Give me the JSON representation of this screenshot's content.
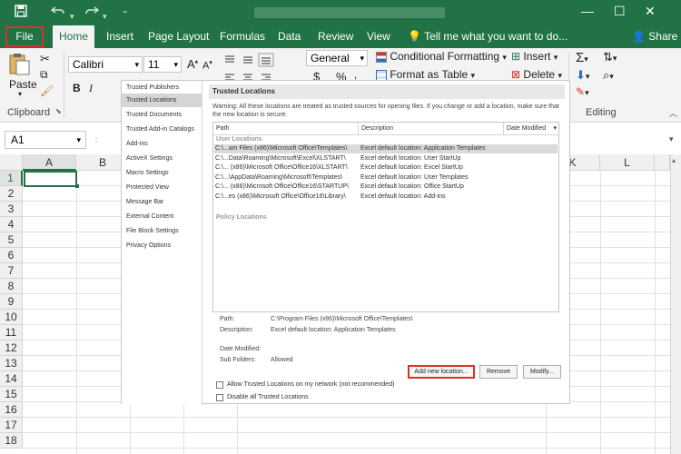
{
  "titlebar": {
    "save_icon": "save-icon",
    "undo_icon": "undo-icon",
    "redo_icon": "redo-icon",
    "accent": "#217346"
  },
  "tabs": [
    {
      "label": "File"
    },
    {
      "label": "Home"
    },
    {
      "label": "Insert"
    },
    {
      "label": "Page Layout"
    },
    {
      "label": "Formulas"
    },
    {
      "label": "Data"
    },
    {
      "label": "Review"
    },
    {
      "label": "View"
    }
  ],
  "tell_me": "Tell me what you want to do...",
  "share": "Share",
  "ribbon": {
    "paste": "Paste",
    "clipboard": "Clipboard",
    "font_name": "Calibri",
    "font_size": "11",
    "bold": "B",
    "italic": "I",
    "number_format": "General",
    "currency": "$",
    "percent": "%",
    "conditional_formatting": "Conditional Formatting",
    "format_as_table": "Format as Table",
    "insert": "Insert",
    "delete": "Delete",
    "editing": "Editing",
    "grow_font": "A",
    "shrink_font": "A"
  },
  "name_box": "A1",
  "columns": [
    "A",
    "B",
    "K",
    "L"
  ],
  "rows": [
    "1",
    "2",
    "3",
    "4",
    "5",
    "6",
    "7",
    "8",
    "9",
    "10",
    "11",
    "12",
    "13",
    "14",
    "15",
    "16",
    "17",
    "18"
  ],
  "nav": {
    "items": [
      "Trusted Publishers",
      "Trusted Locations",
      "Trusted Documents",
      "Trusted Add-in Catalogs",
      "Add-ins",
      "ActiveX Settings",
      "Macro Settings",
      "Protected View",
      "Message Bar",
      "External Content",
      "File Block Settings",
      "Privacy Options"
    ]
  },
  "panel": {
    "title": "Trusted Locations",
    "warning": "Warning: All these locations are treated as trusted sources for opening files.  If you change or add a location, make sure that the new location is secure.",
    "col_path": "Path",
    "col_description": "Description",
    "col_date": "Date Modified",
    "user_locations": "User Locations",
    "policy_locations": "Policy Locations",
    "rows": [
      {
        "path": "C:\\...am Files (x86)\\Microsoft Office\\Templates\\",
        "desc": "Excel default location: Application Templates"
      },
      {
        "path": "C:\\...Data\\Roaming\\Microsoft\\Excel\\XLSTART\\",
        "desc": "Excel default location: User StartUp"
      },
      {
        "path": "C:\\... (x86)\\Microsoft Office\\Office16\\XLSTART\\",
        "desc": "Excel default location: Excel StartUp"
      },
      {
        "path": "C:\\...\\AppData\\Roaming\\Microsoft\\Templates\\",
        "desc": "Excel default location: User Templates"
      },
      {
        "path": "C:\\... (x86)\\Microsoft Office\\Office16\\STARTUP\\",
        "desc": "Excel default location: Office StartUp"
      },
      {
        "path": "C:\\...es (x86)\\Microsoft Office\\Office16\\Library\\",
        "desc": "Excel default location: Add-ins"
      }
    ],
    "detail": {
      "path_label": "Path:",
      "path_value": "C:\\Program Files (x86)\\Microsoft Office\\Templates\\",
      "desc_label": "Description:",
      "desc_value": "Excel default location: Application Templates",
      "date_label": "Date Modified:",
      "sub_label": "Sub Folders:",
      "sub_value": "Allowed"
    },
    "buttons": {
      "add": "Add new location...",
      "remove": "Remove",
      "modify": "Modify..."
    },
    "allow_network": "Allow Trusted Locations on my network (not recommended)",
    "disable_all": "Disable all Trusted Locations"
  }
}
